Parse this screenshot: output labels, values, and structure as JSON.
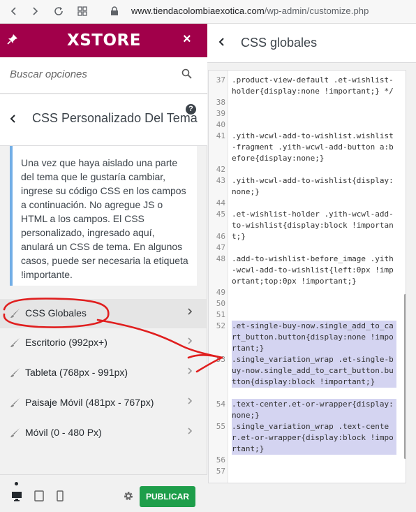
{
  "browser": {
    "url_host": "www.tiendacolombiaexotica.com",
    "url_path": "/wp-admin/customize.php"
  },
  "brand": {
    "logo": "XSTORE",
    "close": "×",
    "accent": "#a1004a"
  },
  "search": {
    "placeholder": "Buscar opciones"
  },
  "section": {
    "title": "CSS Personalizado Del Tema",
    "help": "?"
  },
  "description": "Una vez que haya aislado una parte del tema que le gustaría cambiar, ingrese su código CSS en los campos a continuación. No agregue JS o HTML a los campos. El CSS personalizado, ingresado aquí, anulará un CSS de tema. En algunos casos, puede ser necesaria la etiqueta !importante.",
  "menu": [
    {
      "label": "CSS Globales"
    },
    {
      "label": "Escritorio (992px+)"
    },
    {
      "label": "Tableta (768px - 991px)"
    },
    {
      "label": "Paisaje Móvil (481px - 767px)"
    },
    {
      "label": "Móvil (0 - 480 Px)"
    }
  ],
  "footer": {
    "publish": "PUBLICAR",
    "publish_color": "#1e9e4a"
  },
  "right": {
    "title": "CSS globales"
  },
  "code_lines": [
    {
      "n": "37",
      "t": ".product-view-default .et-wishlist-holder{display:none !important;} */"
    },
    {
      "n": "38",
      "t": ""
    },
    {
      "n": "39",
      "t": ""
    },
    {
      "n": "40",
      "t": ""
    },
    {
      "n": "41",
      "t": ".yith-wcwl-add-to-wishlist.wishlist-fragment .yith-wcwl-add-button a:before{display:none;}"
    },
    {
      "n": "42",
      "t": ""
    },
    {
      "n": "43",
      "t": ".yith-wcwl-add-to-wishlist{display:none;}"
    },
    {
      "n": "44",
      "t": ""
    },
    {
      "n": "45",
      "t": ".et-wishlist-holder .yith-wcwl-add-to-wishlist{display:block !important;}"
    },
    {
      "n": "46",
      "t": ""
    },
    {
      "n": "47",
      "t": ""
    },
    {
      "n": "48",
      "t": ".add-to-wishlist-before_image .yith-wcwl-add-to-wishlist{left:0px !important;top:0px !important;}"
    },
    {
      "n": "49",
      "t": ""
    },
    {
      "n": "50",
      "t": ""
    },
    {
      "n": "51",
      "t": ""
    },
    {
      "n": "52",
      "t": ".et-single-buy-now.single_add_to_cart_button.button{display:none !important;}"
    },
    {
      "n": "53",
      "t": ".single_variation_wrap .et-single-buy-now.single_add_to_cart_button.button{display:block !important;}"
    },
    {
      "n": "54",
      "t": ".text-center.et-or-wrapper{display:none;}"
    },
    {
      "n": "55",
      "t": ".single_variation_wrap .text-center.et-or-wrapper{display:block !important;}"
    },
    {
      "n": "56",
      "t": ""
    },
    {
      "n": "57",
      "t": ""
    }
  ]
}
